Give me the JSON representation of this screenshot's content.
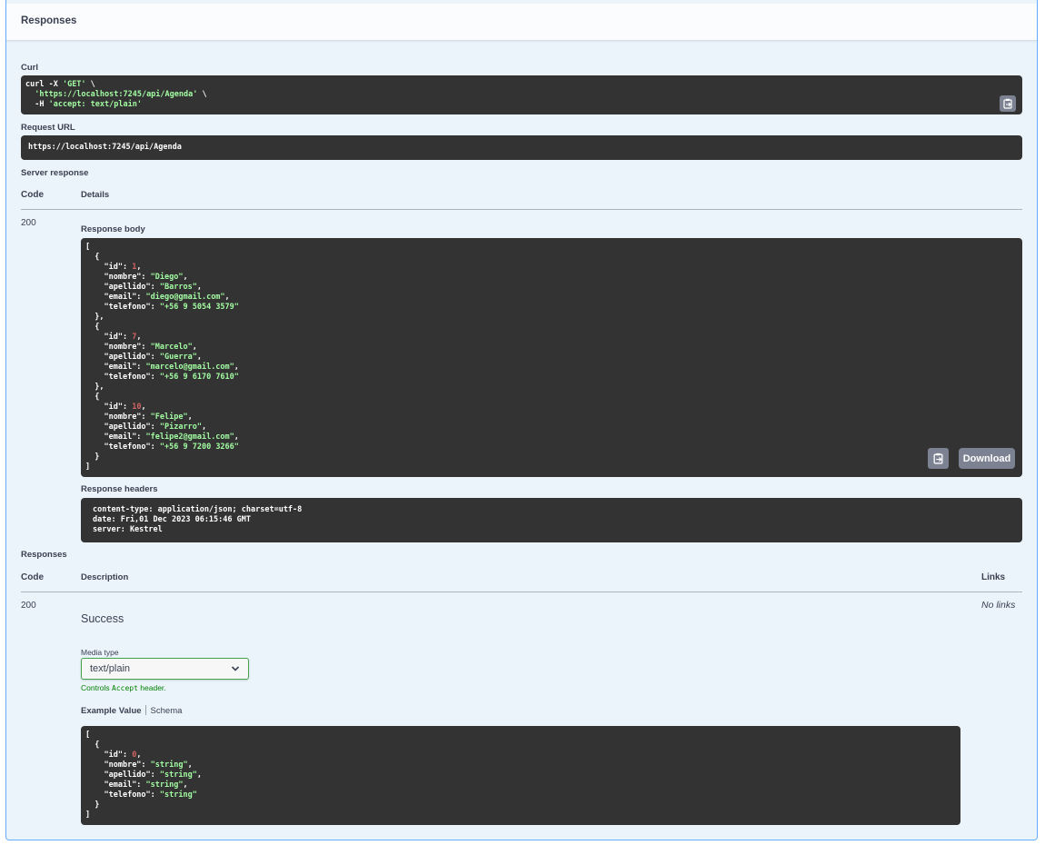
{
  "panel": {
    "title": "Responses"
  },
  "curl": {
    "label": "Curl",
    "line1_a": "curl -X ",
    "line1_method": "'GET'",
    "line1_b": " \\",
    "line2_url": "'https://localhost:7245/api/Agenda'",
    "line2_b": " \\",
    "line3_a": "-H ",
    "line3_header": "'accept: text/plain'",
    "copy_icon": "copy-to-clipboard-icon"
  },
  "request_url": {
    "label": "Request URL",
    "value": "https://localhost:7245/api/Agenda"
  },
  "server_response": {
    "label": "Server response",
    "col_code": "Code",
    "col_details": "Details",
    "code": "200",
    "body_label": "Response body",
    "body_open": "[",
    "body_close": "]",
    "obj_open": "{",
    "obj_close": "}",
    "obj_close_comma": "},",
    "items": [
      {
        "id": "1",
        "nombre": "\"Diego\"",
        "apellido": "\"Barros\"",
        "email": "\"diego@gmail.com\"",
        "telefono": "\"+56 9 5054 3579\""
      },
      {
        "id": "7",
        "nombre": "\"Marcelo\"",
        "apellido": "\"Guerra\"",
        "email": "\"marcelo@gmail.com\"",
        "telefono": "\"+56 9 6170 7610\""
      },
      {
        "id": "10",
        "nombre": "\"Felipe\"",
        "apellido": "\"Pizarro\"",
        "email": "\"felipe2@gmail.com\"",
        "telefono": "\"+56 9 7200 3266\""
      }
    ],
    "keys": {
      "id": "\"id\": ",
      "nombre": "\"nombre\": ",
      "apellido": "\"apellido\": ",
      "email": "\"email\": ",
      "telefono": "\"telefono\": "
    },
    "download_label": "Download",
    "headers_label": "Response headers",
    "headers": [
      "content-type: application/json; charset=utf-8",
      "date: Fri,01 Dec 2023 06:15:46 GMT",
      "server: Kestrel"
    ]
  },
  "responses": {
    "label": "Responses",
    "col_code": "Code",
    "col_description": "Description",
    "col_links": "Links",
    "code": "200",
    "description": "Success",
    "links": "No links",
    "media_type_label": "Media type",
    "media_type_value": "text/plain",
    "controls_a": "Controls ",
    "controls_code": "Accept",
    "controls_b": " header.",
    "tab_example": "Example Value",
    "tab_schema": "Schema",
    "example": {
      "open": "[",
      "close": "]",
      "obj_open": "{",
      "obj_close": "}",
      "id_key": "\"id\": ",
      "id_val": "0",
      "nombre_key": "\"nombre\": ",
      "nombre_val": "\"string\"",
      "apellido_key": "\"apellido\": ",
      "apellido_val": "\"string\"",
      "email_key": "\"email\": ",
      "email_val": "\"string\"",
      "telefono_key": "\"telefono\": ",
      "telefono_val": "\"string\""
    }
  },
  "colors": {
    "panel_bg": "#ebf3fb",
    "panel_border": "#61affe",
    "code_bg": "#333333",
    "string": "#a2fca2",
    "number": "#d36363",
    "select_border": "#41a447"
  }
}
